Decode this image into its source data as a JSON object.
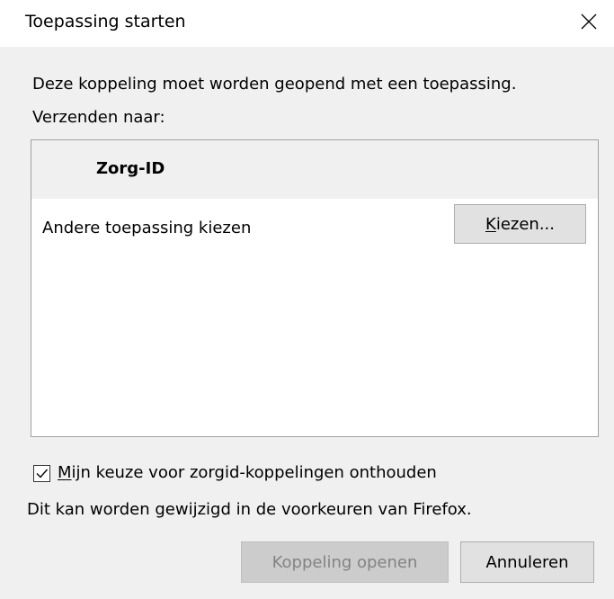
{
  "window": {
    "title": "Toepassing starten",
    "close_icon": "close-icon"
  },
  "dialog": {
    "message": "Deze koppeling moet worden geopend met een toepassing.",
    "send_to_label": "Verzenden naar:",
    "list": {
      "header_item": "Zorg-ID",
      "other_app_label": "Andere toepassing kiezen",
      "choose_button": {
        "accesskey": "K",
        "rest": "iezen..."
      }
    },
    "remember_checkbox": {
      "checked": true,
      "accesskey": "M",
      "rest": "ijn keuze voor zorgid-koppelingen onthouden"
    },
    "preferences_note": "Dit kan worden gewijzigd in de voorkeuren van Firefox.",
    "buttons": {
      "open": "Koppeling openen",
      "open_enabled": false,
      "cancel": "Annuleren"
    }
  },
  "colors": {
    "content_bg": "#f0f0f0",
    "button_bg": "#e1e1e1",
    "disabled_text": "#838383"
  }
}
